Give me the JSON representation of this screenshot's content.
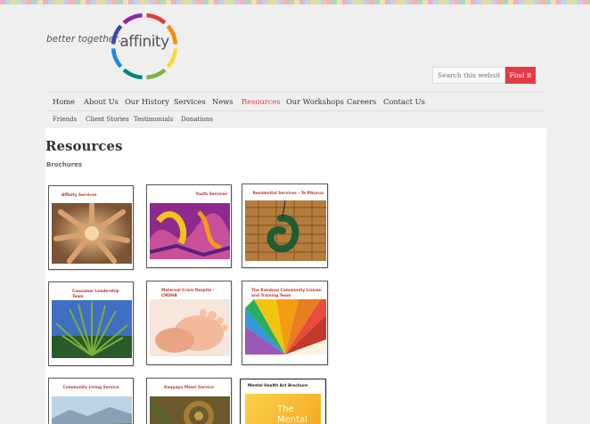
{
  "header": {
    "tagline": "better together…",
    "logo_text": "affinity",
    "logo_colors": [
      "#e53935",
      "#fb8c00",
      "#fdd835",
      "#7cb342",
      "#00897b",
      "#1e88e5",
      "#3949ab",
      "#8e24aa"
    ]
  },
  "search": {
    "placeholder": "Search this website …",
    "button_label": "Find it",
    "button_color": "#e63946"
  },
  "main_nav": [
    {
      "label": "Home",
      "active": false
    },
    {
      "label": "About Us",
      "active": false
    },
    {
      "label": "Our History",
      "active": false
    },
    {
      "label": "Services",
      "active": false
    },
    {
      "label": "News",
      "active": false
    },
    {
      "label": "Resources",
      "active": true
    },
    {
      "label": "Our Workshops",
      "active": false
    },
    {
      "label": "Careers",
      "active": false
    },
    {
      "label": "Contact Us",
      "active": false
    }
  ],
  "sub_nav": [
    "Friends",
    "Client Stories",
    "Testimonials",
    "Donations"
  ],
  "page": {
    "title": "Resources",
    "section": "Brochures"
  },
  "brochures": [
    {
      "title": "Affinity Services",
      "image": "hands-circle",
      "align": "left"
    },
    {
      "title": "Youth Services",
      "image": "purple-graffiti",
      "align": "right"
    },
    {
      "title": "Residential Services – Te Pikorua",
      "image": "greenstone-pendant",
      "align": "right"
    },
    {
      "title": "Consumer Leadership Team",
      "image": "flax-plant",
      "align": "left"
    },
    {
      "title": "Maternal Crisis Respite - CMDHB",
      "image": "baby-feet",
      "align": "left"
    },
    {
      "title": "The Rainbow Community Liaison and Training Team",
      "image": "rainbow-paper",
      "align": "left"
    },
    {
      "title": "Community Living Service",
      "image": "landscape",
      "align": "center"
    },
    {
      "title": "Kaupapa Māori Service",
      "image": "koru-fern",
      "align": "center"
    },
    {
      "title": "Mental Health Act Brochure",
      "image": "yellow-cover",
      "align": "left",
      "cover_text": "The Mental"
    }
  ]
}
